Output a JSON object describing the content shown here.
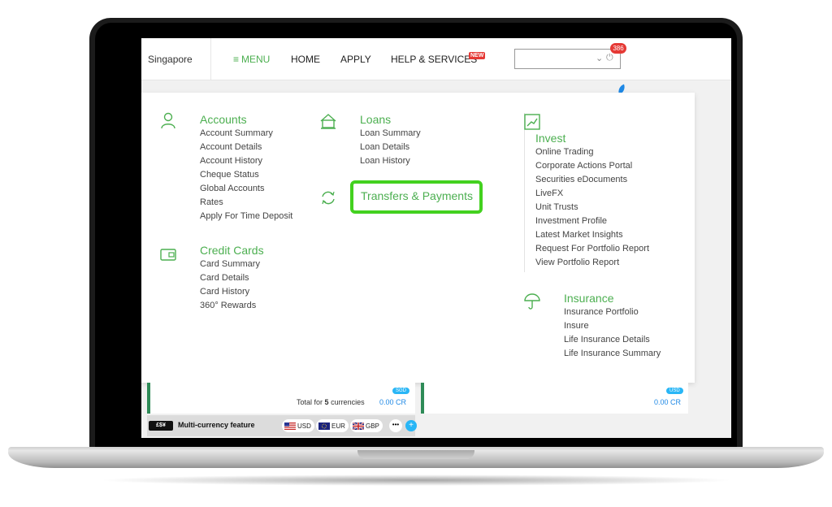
{
  "header": {
    "country": "Singapore",
    "menu_label": "MENU",
    "menu_icon": "≡",
    "nav": {
      "home": "HOME",
      "apply": "APPLY",
      "help": "HELP & SERVICES"
    },
    "new_badge": "NEW",
    "notification_count": "386"
  },
  "menu": {
    "accounts": {
      "title": "Accounts",
      "items": [
        "Account Summary",
        "Account Details",
        "Account History",
        "Cheque Status",
        "Global Accounts",
        "Rates",
        "Apply For Time Deposit"
      ]
    },
    "credit_cards": {
      "title": "Credit Cards",
      "items": [
        "Card Summary",
        "Card Details",
        "Card History",
        "360° Rewards"
      ]
    },
    "loans": {
      "title": "Loans",
      "items": [
        "Loan Summary",
        "Loan Details",
        "Loan History"
      ]
    },
    "transfers": {
      "title": "Transfers & Payments"
    },
    "invest": {
      "title": "Invest",
      "items": [
        "Online Trading",
        "Corporate Actions Portal",
        "Securities eDocuments",
        "LiveFX",
        "Unit Trusts",
        "Investment Profile",
        "Latest Market Insights",
        "Request For Portfolio Report",
        "View Portfolio Report"
      ]
    },
    "insurance": {
      "title": "Insurance",
      "items": [
        "Insurance Portfolio",
        "Insure",
        "Life Insurance Details",
        "Life Insurance Summary"
      ]
    }
  },
  "summary": {
    "card1": {
      "currency_pill": "SGD",
      "total_prefix": "Total for",
      "total_count": "5",
      "total_suffix": "currencies",
      "amount": "0.00 CR"
    },
    "card2": {
      "currency_pill": "USD",
      "amount": "0.00 CR"
    }
  },
  "multicurrency": {
    "logo_text": "£$¥",
    "label": "Multi-currency feature",
    "currencies": [
      "USD",
      "EUR",
      "GBP"
    ],
    "more": "•••",
    "add": "+"
  },
  "colors": {
    "accent_green": "#4caf50",
    "highlight_green": "#43d11f",
    "badge_red": "#e53935",
    "link_blue": "#1e88e5"
  }
}
